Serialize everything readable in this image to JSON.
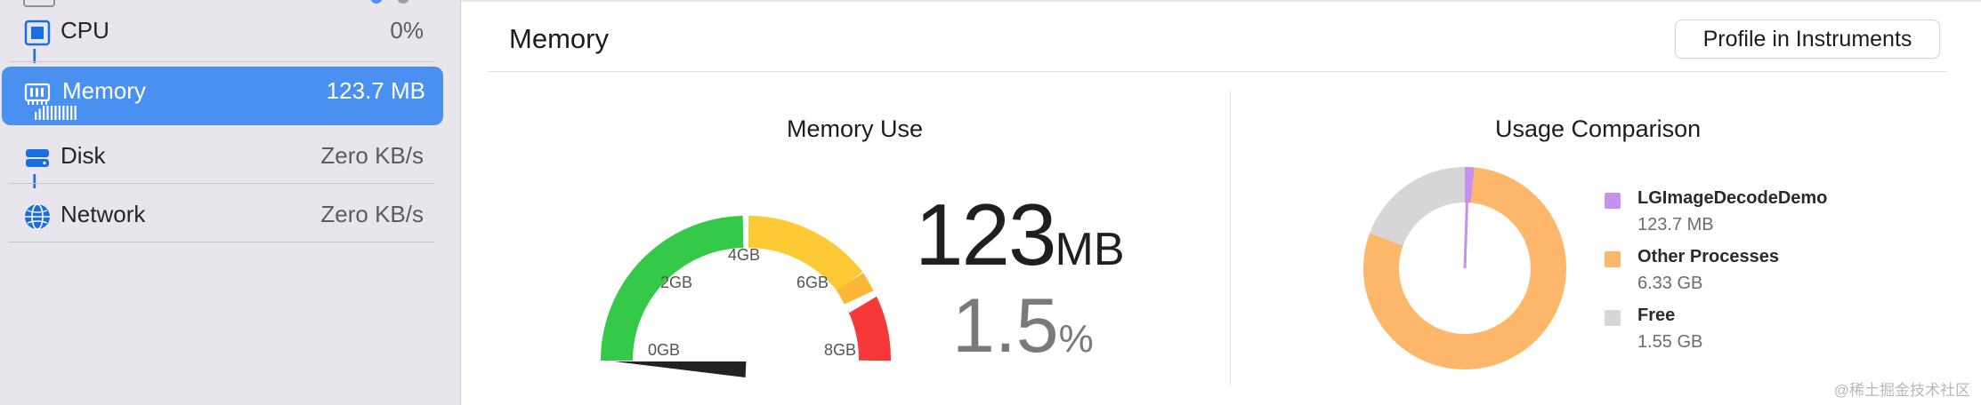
{
  "sidebar": {
    "items": [
      {
        "label": "CPU",
        "value": "0%",
        "icon": "cpu-icon"
      },
      {
        "label": "Memory",
        "value": "123.7 MB",
        "icon": "memory-chip-icon",
        "selected": true
      },
      {
        "label": "Disk",
        "value": "Zero KB/s",
        "icon": "disk-icon"
      },
      {
        "label": "Network",
        "value": "Zero KB/s",
        "icon": "globe-icon"
      }
    ]
  },
  "main": {
    "title": "Memory",
    "profile_button": "Profile in Instruments",
    "memory_use": {
      "title": "Memory Use",
      "gauge_ticks": [
        "0GB",
        "2GB",
        "4GB",
        "6GB",
        "8GB"
      ],
      "gauge_value_gb": 0.12,
      "gauge_max_gb": 8,
      "big_value": "123",
      "big_unit": "MB",
      "percent_value": "1.5",
      "percent_unit": "%"
    },
    "usage_comparison": {
      "title": "Usage Comparison",
      "legend": [
        {
          "name": "LGImageDecodeDemo",
          "value": "123.7 MB",
          "color": "#c790ec"
        },
        {
          "name": "Other Processes",
          "value": "6.33 GB",
          "color": "#fdb76a"
        },
        {
          "name": "Free",
          "value": "1.55 GB",
          "color": "#d6d6d6"
        }
      ]
    }
  },
  "colors": {
    "accent": "#4a90f1",
    "gauge_green": "#35c94a",
    "gauge_yellow": "#fdc935",
    "gauge_orange": "#fdb535",
    "gauge_red": "#f6383a"
  },
  "watermark": "@稀土掘金技术社区"
}
